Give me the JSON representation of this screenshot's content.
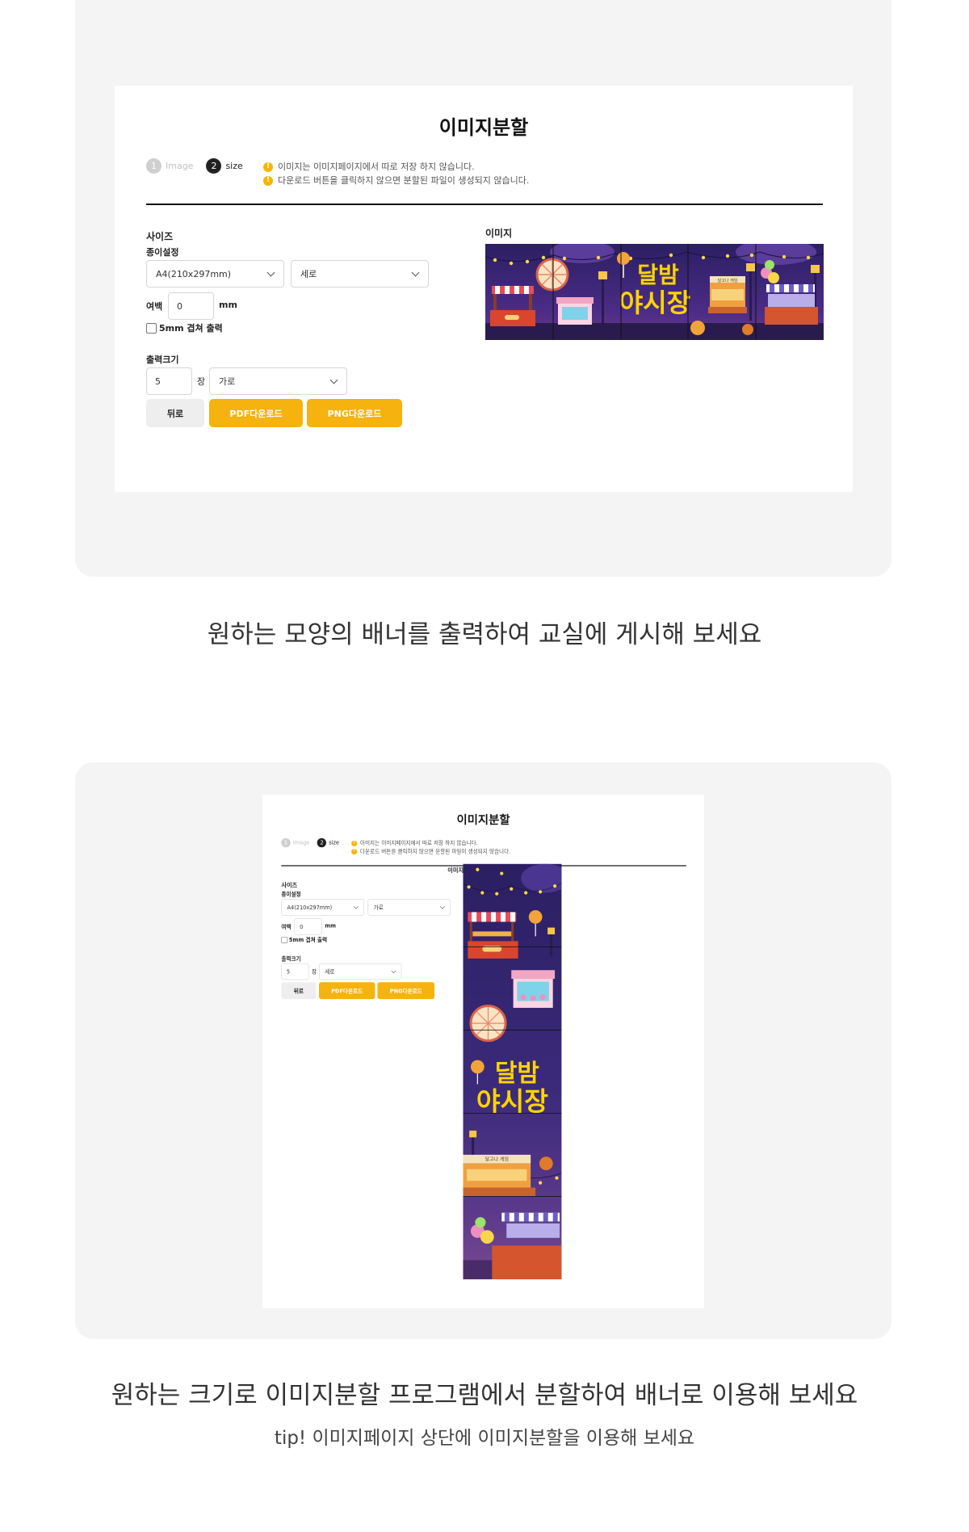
{
  "screens": [
    {
      "title": "이미지분할",
      "steps": [
        {
          "num": "1",
          "label": "Image"
        },
        {
          "num": "2",
          "label": "size"
        }
      ],
      "notices": [
        "이미지는 이미지페이지에서 따로 저장 하지 않습니다.",
        "다운로드 버튼을 클릭하지 않으면 분할된 파일이 생성되지 않습니다."
      ],
      "size_section_label": "사이즈",
      "paper_setting_label": "종이설정",
      "paper_select": "A4(210x297mm)",
      "orientation_select": "세로",
      "margin_label": "여백",
      "margin_value": "0",
      "margin_unit": "mm",
      "overlap_label": "5mm 겹쳐 출력",
      "output_size_label": "출력크기",
      "output_count": "5",
      "output_unit": "장",
      "output_direction": "가로",
      "back_button": "뒤로",
      "pdf_button": "PDF다운로드",
      "png_button": "PNG다운로드",
      "image_label": "이미지",
      "banner_title_line1": "달밤",
      "banner_title_line2": "야시장",
      "banner_sign": "달고나 게임"
    },
    {
      "title": "이미지분할",
      "steps": [
        {
          "num": "1",
          "label": "Image"
        },
        {
          "num": "2",
          "label": "size"
        }
      ],
      "notices": [
        "이미지는 이미지페이지에서 따로 저장 하지 않습니다.",
        "다운로드 버튼을 클릭하지 않으면 분할된 파일이 생성되지 않습니다."
      ],
      "size_section_label": "사이즈",
      "paper_setting_label": "종이설정",
      "paper_select": "A4(210x297mm)",
      "orientation_select": "가로",
      "margin_label": "여백",
      "margin_value": "0",
      "margin_unit": "mm",
      "overlap_label": "5mm 겹쳐 출력",
      "output_size_label": "출력크기",
      "output_count": "5",
      "output_unit": "장",
      "output_direction": "세로",
      "back_button": "뒤로",
      "pdf_button": "PDF다운로드",
      "png_button": "PNG다운로드",
      "image_label": "이미지",
      "banner_title_line1": "달밤",
      "banner_title_line2": "야시장",
      "banner_sign": "달고나 게임"
    }
  ],
  "captions": {
    "first": "원하는 모양의 배너를 출력하여 교실에 게시해 보세요",
    "second": "원하는 크기로 이미지분할 프로그램에서 분할하여 배너로 이용해 보세요",
    "tip": "tip! 이미지페이지 상단에 이미지분할을 이용해 보세요"
  },
  "colors": {
    "accent": "#f6b20e",
    "panel_bg": "#f4f4f4",
    "banner_sky": "#3b2a7a",
    "banner_title": "#ffd400"
  }
}
